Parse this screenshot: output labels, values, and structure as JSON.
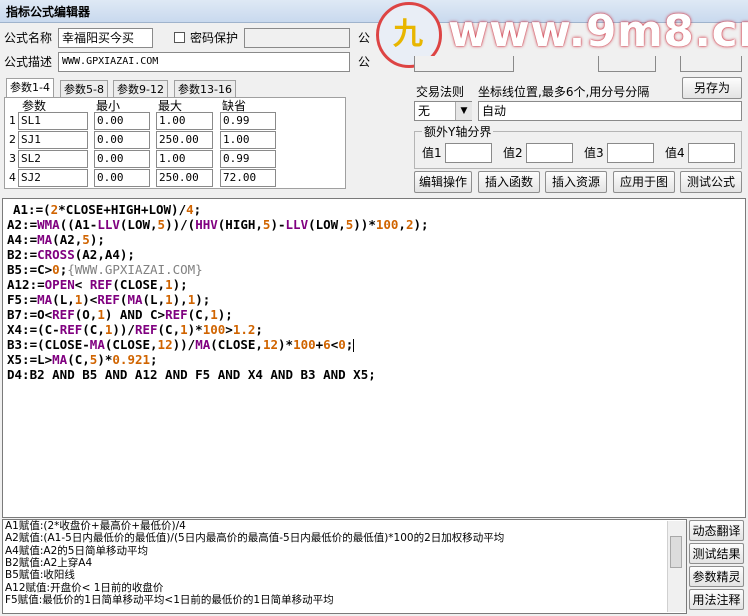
{
  "window": {
    "title": "指标公式编辑器"
  },
  "watermark": {
    "text": "www.9m8.cn",
    "logo_char": "九"
  },
  "form": {
    "name_label": "公式名称",
    "name_value": "幸福阳买今买",
    "password_label": "密码保护",
    "desc_label": "公式描述",
    "desc_value": "WWW.GPXIAZAI.COM",
    "clipped_label": "公"
  },
  "tabs": [
    "参数1-4",
    "参数5-8",
    "参数9-12",
    "参数13-16"
  ],
  "params": {
    "headers": [
      "参数",
      "最小",
      "最大",
      "缺省"
    ],
    "rows": [
      {
        "n": "1",
        "name": "SL1",
        "min": "0.00",
        "max": "1.00",
        "def": "0.99"
      },
      {
        "n": "2",
        "name": "SJ1",
        "min": "0.00",
        "max": "250.00",
        "def": "1.00"
      },
      {
        "n": "3",
        "name": "SL2",
        "min": "0.00",
        "max": "1.00",
        "def": "0.99"
      },
      {
        "n": "4",
        "name": "SJ2",
        "min": "0.00",
        "max": "250.00",
        "def": "72.00"
      }
    ]
  },
  "right": {
    "trade_rule_label": "交易法则",
    "trade_rule_value": "无",
    "coord_label": "坐标线位置,最多6个,用分号分隔",
    "coord_value": "自动",
    "save_as": "另存为",
    "yaxis_label": "额外Y轴分界",
    "val_labels": [
      "值1",
      "值2",
      "值3",
      "值4"
    ]
  },
  "buttons": [
    "编辑操作",
    "插入函数",
    "插入资源",
    "应用于图",
    "测试公式"
  ],
  "side_buttons": [
    "动态翻译",
    "测试结果",
    "参数精灵",
    "用法注释"
  ],
  "code": [
    [
      [
        "A1:=(",
        ""
      ],
      [
        "2",
        "num"
      ],
      [
        "*CLOSE+HIGH+LOW)/",
        ""
      ],
      [
        "4",
        "num"
      ],
      [
        ";",
        ""
      ]
    ],
    [
      [
        "A2:=",
        ""
      ],
      [
        "WMA",
        "kw"
      ],
      [
        "((A1-",
        ""
      ],
      [
        "LLV",
        "kw"
      ],
      [
        "(LOW,",
        ""
      ],
      [
        "5",
        "num"
      ],
      [
        "))/(",
        ""
      ],
      [
        "HHV",
        "kw"
      ],
      [
        "(HIGH,",
        ""
      ],
      [
        "5",
        "num"
      ],
      [
        ")-",
        ""
      ],
      [
        "LLV",
        "kw"
      ],
      [
        "(LOW,",
        ""
      ],
      [
        "5",
        "num"
      ],
      [
        "))*",
        ""
      ],
      [
        "100",
        "num"
      ],
      [
        ",",
        ""
      ],
      [
        "2",
        "num"
      ],
      [
        ");",
        ""
      ]
    ],
    [
      [
        "A4:=",
        ""
      ],
      [
        "MA",
        "kw"
      ],
      [
        "(A2,",
        ""
      ],
      [
        "5",
        "num"
      ],
      [
        ");",
        ""
      ]
    ],
    [
      [
        "B2:=",
        ""
      ],
      [
        "CROSS",
        "kw"
      ],
      [
        "(A2,A4);",
        ""
      ]
    ],
    [
      [
        "B5:=C>",
        ""
      ],
      [
        "0",
        "num"
      ],
      [
        ";",
        ""
      ],
      [
        "{WWW.GPXIAZAI.COM}",
        "cmt"
      ]
    ],
    [
      [
        "A12:=",
        ""
      ],
      [
        "OPEN",
        "kw"
      ],
      [
        "< ",
        ""
      ],
      [
        "REF",
        "kw"
      ],
      [
        "(CLOSE,",
        ""
      ],
      [
        "1",
        "num"
      ],
      [
        ");",
        ""
      ]
    ],
    [
      [
        "F5:=",
        ""
      ],
      [
        "MA",
        "kw"
      ],
      [
        "(L,",
        ""
      ],
      [
        "1",
        "num"
      ],
      [
        ")<",
        ""
      ],
      [
        "REF",
        "kw"
      ],
      [
        "(",
        ""
      ],
      [
        "MA",
        "kw"
      ],
      [
        "(L,",
        ""
      ],
      [
        "1",
        "num"
      ],
      [
        "),",
        ""
      ],
      [
        "1",
        "num"
      ],
      [
        ");",
        ""
      ]
    ],
    [
      [
        "B7:=O<",
        ""
      ],
      [
        "REF",
        "kw"
      ],
      [
        "(O,",
        ""
      ],
      [
        "1",
        "num"
      ],
      [
        ") AND C>",
        ""
      ],
      [
        "REF",
        "kw"
      ],
      [
        "(C,",
        ""
      ],
      [
        "1",
        "num"
      ],
      [
        ");",
        ""
      ]
    ],
    [
      [
        "X4:=(C-",
        ""
      ],
      [
        "REF",
        "kw"
      ],
      [
        "(C,",
        ""
      ],
      [
        "1",
        "num"
      ],
      [
        "))/",
        ""
      ],
      [
        "REF",
        "kw"
      ],
      [
        "(C,",
        ""
      ],
      [
        "1",
        "num"
      ],
      [
        ")*",
        ""
      ],
      [
        "100",
        "num"
      ],
      [
        ">",
        ""
      ],
      [
        "1.2",
        "num"
      ],
      [
        ";",
        ""
      ]
    ],
    [
      [
        "B3:=(CLOSE-",
        ""
      ],
      [
        "MA",
        "kw"
      ],
      [
        "(CLOSE,",
        ""
      ],
      [
        "12",
        "num"
      ],
      [
        "))/",
        ""
      ],
      [
        "MA",
        "kw"
      ],
      [
        "(CLOSE,",
        ""
      ],
      [
        "12",
        "num"
      ],
      [
        ")*",
        ""
      ],
      [
        "100",
        "num"
      ],
      [
        "+",
        ""
      ],
      [
        "6",
        "num"
      ],
      [
        "<",
        ""
      ],
      [
        "0",
        "num"
      ],
      [
        ";",
        ""
      ]
    ],
    [
      [
        "X5:=L>",
        ""
      ],
      [
        "MA",
        "kw"
      ],
      [
        "(C,",
        ""
      ],
      [
        "5",
        "num"
      ],
      [
        ")*",
        ""
      ],
      [
        "0.921",
        "num"
      ],
      [
        ";",
        ""
      ]
    ],
    [
      [
        "D4:B2 AND B5 AND A12 AND F5 AND X4 AND B3 AND X5;",
        ""
      ]
    ]
  ],
  "messages": [
    "A1赋值:(2*收盘价+最高价+最低价)/4",
    "A2赋值:(A1-5日内最低价的最低值)/(5日内最高价的最高值-5日内最低价的最低值)*100的2日加权移动平均",
    "A4赋值:A2的5日简单移动平均",
    "B2赋值:A2上穿A4",
    "B5赋值:收阳线",
    "A12赋值:开盘价< 1日前的收盘价",
    "F5赋值:最低价的1日简单移动平均<1日前的最低价的1日简单移动平均"
  ],
  "colors": {
    "keyword": "#800080",
    "number": "#d06400",
    "comment": "#808080"
  }
}
